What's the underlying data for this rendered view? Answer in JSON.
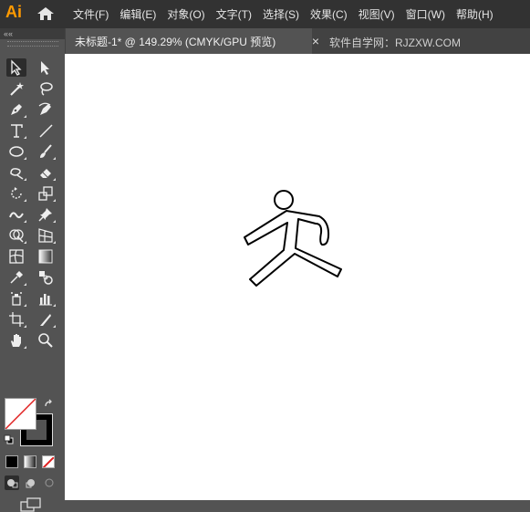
{
  "app": {
    "logo": "Ai"
  },
  "menu": {
    "items": [
      "文件(F)",
      "编辑(E)",
      "对象(O)",
      "文字(T)",
      "选择(S)",
      "效果(C)",
      "视图(V)",
      "窗口(W)",
      "帮助(H)"
    ]
  },
  "tab": {
    "title": "未标题-1* @ 149.29% (CMYK/GPU 预览)",
    "close": "×"
  },
  "watermark": "软件自学网：RJZXW.COM",
  "panel": {
    "collapse": "««"
  },
  "tools": [
    "selection-tool",
    "direct-selection-tool",
    "magic-wand-tool",
    "lasso-tool",
    "pen-tool",
    "curvature-tool",
    "type-tool",
    "line-segment-tool",
    "ellipse-tool",
    "paintbrush-tool",
    "shaper-tool",
    "eraser-tool",
    "rotate-tool",
    "scale-tool",
    "warp-tool",
    "puppet-warp-tool",
    "shape-builder-tool",
    "perspective-grid-tool",
    "mesh-tool",
    "gradient-tool",
    "eyedropper-tool",
    "blend-tool",
    "symbol-sprayer-tool",
    "column-graph-tool",
    "artboard-tool",
    "slice-tool",
    "hand-tool",
    "zoom-tool"
  ],
  "colors": {
    "menubar": "#323232",
    "panel": "#535353",
    "canvas": "#ffffff",
    "logo": "#ff9a00",
    "none-slash": "#e02020"
  }
}
